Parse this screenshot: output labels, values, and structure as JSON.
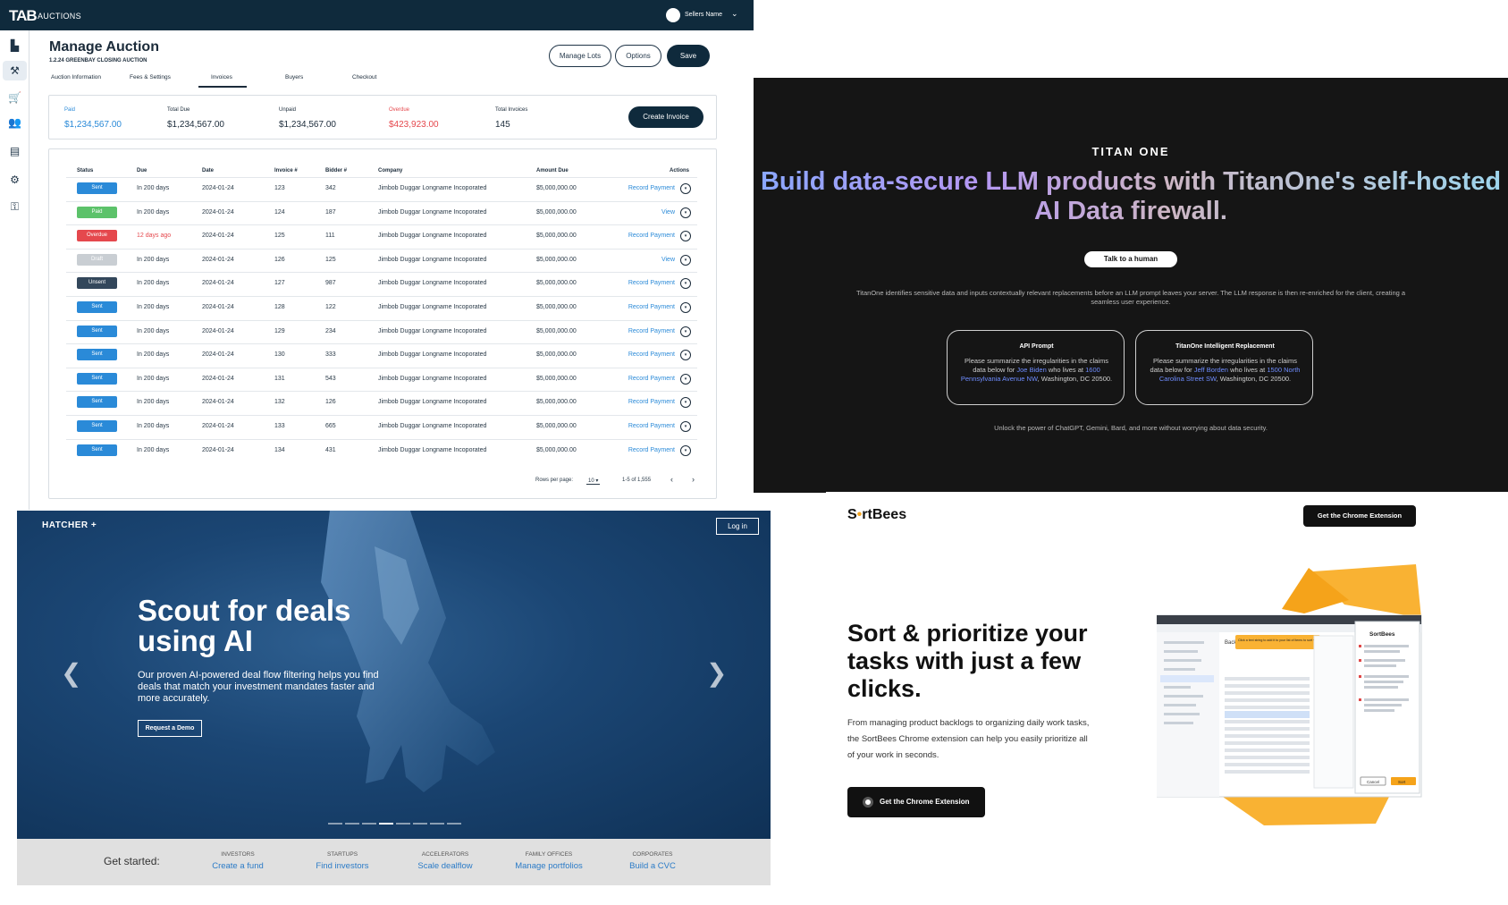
{
  "tab": {
    "logo": "TAB",
    "logo_sub": "AUCTIONS",
    "user_name": "Sellers Name",
    "title": "Manage Auction",
    "subtitle": "1.2.24 GREENBAY CLOSING AUCTION",
    "buttons": {
      "manage_lots": "Manage Lots",
      "options": "Options",
      "save": "Save",
      "create_invoice": "Create Invoice"
    },
    "tabs": [
      "Auction Information",
      "Fees & Settings",
      "Invoices",
      "Buyers",
      "Checkout"
    ],
    "active_tab": "Invoices",
    "summary": [
      {
        "label": "Paid",
        "value": "$1,234,567.00",
        "color": "#2a8ad8"
      },
      {
        "label": "Total Due",
        "value": "$1,234,567.00",
        "color": "#1b2b3a"
      },
      {
        "label": "Unpaid",
        "value": "$1,234,567.00",
        "color": "#1b2b3a"
      },
      {
        "label": "Overdue",
        "value": "$423,923.00",
        "color": "#e5484d"
      },
      {
        "label": "Total Invoices",
        "value": "145",
        "color": "#1b2b3a"
      }
    ],
    "columns": [
      "Status",
      "Due",
      "Date",
      "Invoice #",
      "Bidder #",
      "Company",
      "Amount Due",
      "Actions"
    ],
    "rows": [
      {
        "status": "Sent",
        "due": "In 200 days",
        "date": "2024-01-24",
        "invoice": "123",
        "bidder": "342",
        "company": "Jimbob Duggar Longname Incoporated",
        "amount": "$5,000,000.00",
        "action": "Record Payment"
      },
      {
        "status": "Paid",
        "due": "In 200 days",
        "date": "2024-01-24",
        "invoice": "124",
        "bidder": "187",
        "company": "Jimbob Duggar Longname Incoporated",
        "amount": "$5,000,000.00",
        "action": "View"
      },
      {
        "status": "Overdue",
        "due": "12 days ago",
        "date": "2024-01-24",
        "invoice": "125",
        "bidder": "111",
        "company": "Jimbob Duggar Longname Incoporated",
        "amount": "$5,000,000.00",
        "action": "Record Payment"
      },
      {
        "status": "Draft",
        "due": "In 200 days",
        "date": "2024-01-24",
        "invoice": "126",
        "bidder": "125",
        "company": "Jimbob Duggar Longname Incoporated",
        "amount": "$5,000,000.00",
        "action": "View"
      },
      {
        "status": "Unsent",
        "due": "In 200 days",
        "date": "2024-01-24",
        "invoice": "127",
        "bidder": "987",
        "company": "Jimbob Duggar Longname Incoporated",
        "amount": "$5,000,000.00",
        "action": "Record Payment"
      },
      {
        "status": "Sent",
        "due": "In 200 days",
        "date": "2024-01-24",
        "invoice": "128",
        "bidder": "122",
        "company": "Jimbob Duggar Longname Incoporated",
        "amount": "$5,000,000.00",
        "action": "Record Payment"
      },
      {
        "status": "Sent",
        "due": "In 200 days",
        "date": "2024-01-24",
        "invoice": "129",
        "bidder": "234",
        "company": "Jimbob Duggar Longname Incoporated",
        "amount": "$5,000,000.00",
        "action": "Record Payment"
      },
      {
        "status": "Sent",
        "due": "In 200 days",
        "date": "2024-01-24",
        "invoice": "130",
        "bidder": "333",
        "company": "Jimbob Duggar Longname Incoporated",
        "amount": "$5,000,000.00",
        "action": "Record Payment"
      },
      {
        "status": "Sent",
        "due": "In 200 days",
        "date": "2024-01-24",
        "invoice": "131",
        "bidder": "543",
        "company": "Jimbob Duggar Longname Incoporated",
        "amount": "$5,000,000.00",
        "action": "Record Payment"
      },
      {
        "status": "Sent",
        "due": "In 200 days",
        "date": "2024-01-24",
        "invoice": "132",
        "bidder": "126",
        "company": "Jimbob Duggar Longname Incoporated",
        "amount": "$5,000,000.00",
        "action": "Record Payment"
      },
      {
        "status": "Sent",
        "due": "In 200 days",
        "date": "2024-01-24",
        "invoice": "133",
        "bidder": "665",
        "company": "Jimbob Duggar Longname Incoporated",
        "amount": "$5,000,000.00",
        "action": "Record Payment"
      },
      {
        "status": "Sent",
        "due": "In 200 days",
        "date": "2024-01-24",
        "invoice": "134",
        "bidder": "431",
        "company": "Jimbob Duggar Longname Incoporated",
        "amount": "$5,000,000.00",
        "action": "Record Payment"
      }
    ],
    "status_colors": {
      "Sent": "#2a8ad8",
      "Paid": "#5cc26a",
      "Overdue": "#e5484d",
      "Draft": "#c9ced3",
      "Unsent": "#33475b"
    },
    "overdue_text_color": "#e5484d",
    "pager": {
      "rows_label": "Rows per page:",
      "rows_value": "10",
      "range": "1-5 of 1,555"
    },
    "rail_icons": [
      "dashboard-icon",
      "gavel-icon",
      "cart-icon",
      "users-icon",
      "invoice-icon",
      "gear-icon",
      "key-icon"
    ]
  },
  "titan": {
    "brand": "TITAN ONE",
    "hero": "Build data-secure LLM products with TitanOne's self-hosted AI Data firewall.",
    "cta": "Talk to a human",
    "desc": "TitanOne identifies sensitive data and inputs contextually relevant replacements before an LLM prompt leaves your server. The LLM response is then re-enriched for the client, creating a seamless user experience.",
    "card1": {
      "title": "API Prompt",
      "pre": "Please summarize the irregularities in the claims data below for ",
      "name": "Joe Biden",
      "mid": " who lives at ",
      "addr": "1600 Pennsylvania Avenue NW",
      "post": ", Washington, DC 20500."
    },
    "card2": {
      "title": "TitanOne Intelligent Replacement",
      "pre": "Please summarize the irregularities in the claims data below for ",
      "name": "Jeff Borden",
      "mid": " who lives at ",
      "addr": "1500 North Carolina Street SW",
      "post": ", Washington, DC 20500."
    },
    "foot": "Unlock the power of ChatGPT, Gemini, Bard, and more without worrying about data security."
  },
  "hatcher": {
    "logo": "HATCHER +",
    "login": "Log in",
    "headline_1": "Scout for deals",
    "headline_2": "using AI",
    "paragraph": "Our proven AI-powered deal flow filtering helps you find deals that match your investment mandates faster and more accurately.",
    "demo": "Request a Demo",
    "slides": 8,
    "active_slide": 4,
    "get_started": "Get started:",
    "audiences": [
      {
        "label": "INVESTORS",
        "link": "Create a fund"
      },
      {
        "label": "STARTUPS",
        "link": "Find investors"
      },
      {
        "label": "ACCELERATORS",
        "link": "Scale dealflow"
      },
      {
        "label": "FAMILY OFFICES",
        "link": "Manage portfolios"
      },
      {
        "label": "CORPORATES",
        "link": "Build a CVC"
      }
    ]
  },
  "sortbees": {
    "logo_pre": "S",
    "logo_dot": "•",
    "logo_post": "rtBees",
    "top_button": "Get the Chrome Extension",
    "headline": "Sort & prioritize your tasks with just a few clicks.",
    "paragraph": "From managing product backlogs to organizing daily work tasks, the SortBees Chrome extension can help you easily prioritize all of your work in seconds.",
    "cta": "Get the Chrome Extension",
    "shot": {
      "panel_title": "SortBees",
      "backlog": "Backlog",
      "tooltip": "Click a text string to add it to your list of items to sort with SortBees.",
      "cancel": "Cancel",
      "sort": "Sort"
    }
  }
}
